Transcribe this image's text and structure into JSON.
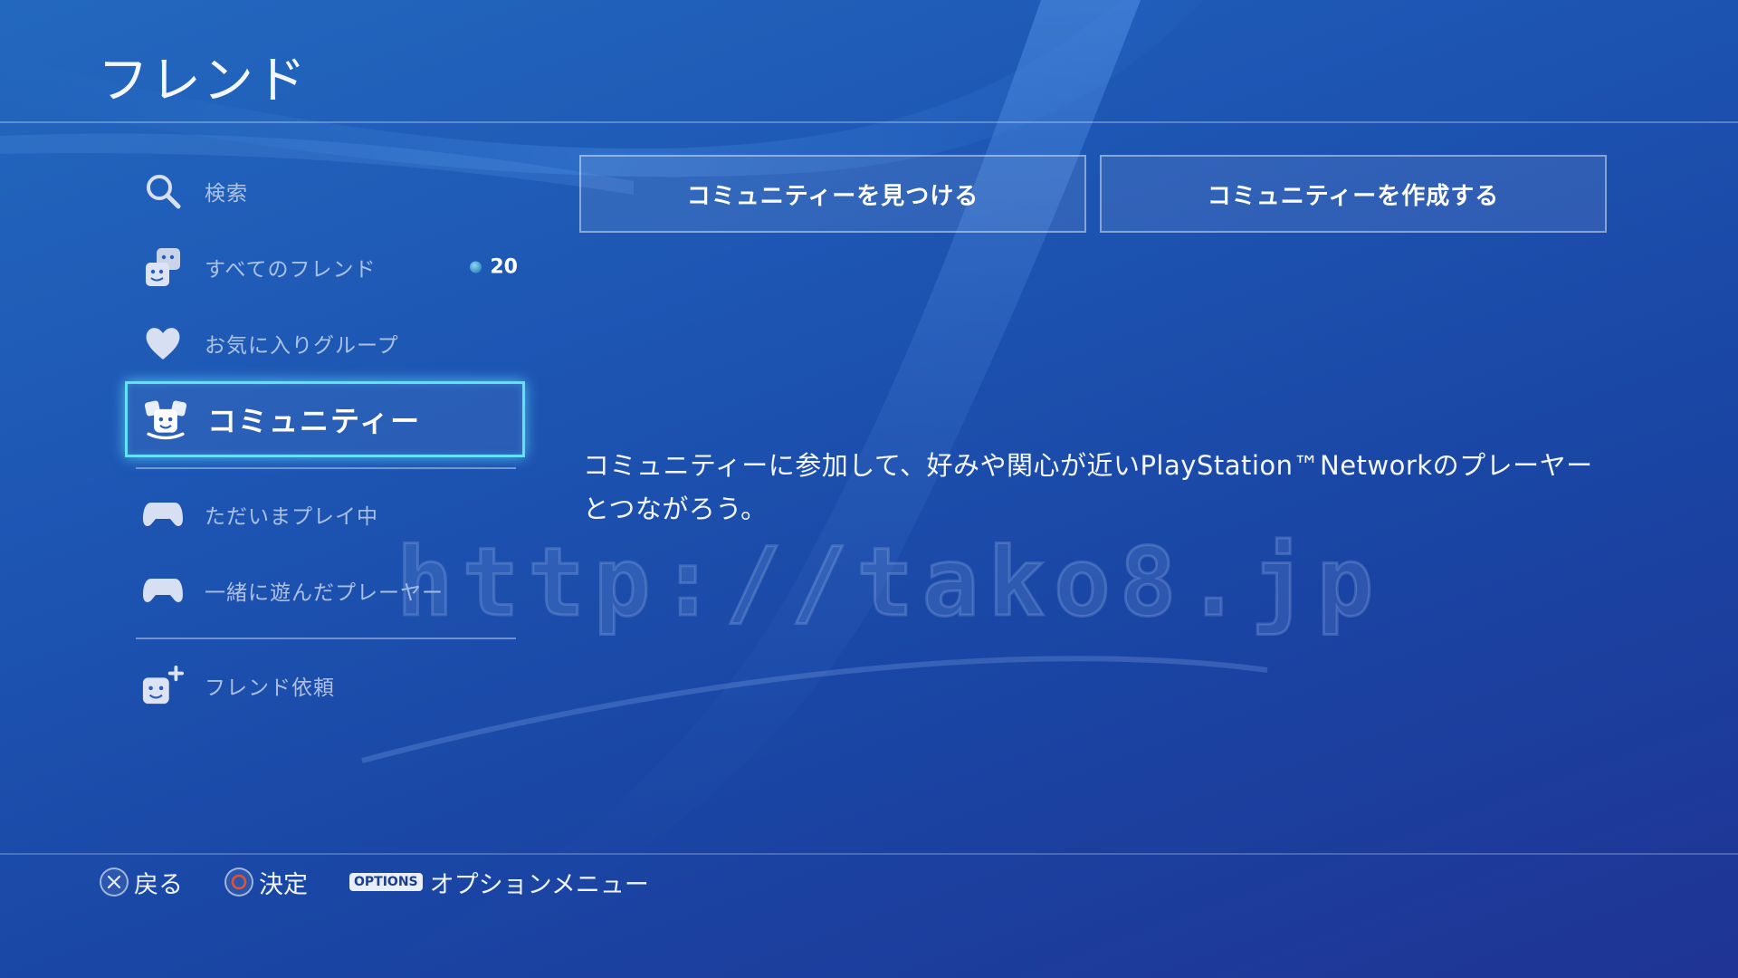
{
  "page": {
    "title": "フレンド"
  },
  "sidebar": {
    "items": [
      {
        "label": "検索",
        "icon": "search-icon"
      },
      {
        "label": "すべてのフレンド",
        "icon": "friends-icon",
        "count": "20"
      },
      {
        "label": "お気に入りグループ",
        "icon": "heart-icon"
      },
      {
        "label": "コミュニティー",
        "icon": "community-icon",
        "selected": true
      },
      {
        "label": "ただいまプレイ中",
        "icon": "gamepad-icon"
      },
      {
        "label": "一緒に遊んだプレーヤー",
        "icon": "gamepad-icon"
      },
      {
        "label": "フレンド依頼",
        "icon": "friend-request-icon"
      }
    ]
  },
  "main": {
    "buttons": [
      {
        "label": "コミュニティーを見つける"
      },
      {
        "label": "コミュニティーを作成する"
      }
    ],
    "description_line1": "コミュニティーに参加して、好みや関心が近いPlayStation™Networkのプレーヤー",
    "description_line2": "とつながろう。"
  },
  "watermark": {
    "text": "http://tako8.jp"
  },
  "footer": {
    "back_label": "戻る",
    "confirm_label": "決定",
    "options_key": "OPTIONS",
    "options_label": "オプションメニュー"
  },
  "colors": {
    "selection_glow": "#63e1ff",
    "background_top": "#2368bf",
    "background_bottom": "#1f3494",
    "circle_button": "#e0532f"
  }
}
